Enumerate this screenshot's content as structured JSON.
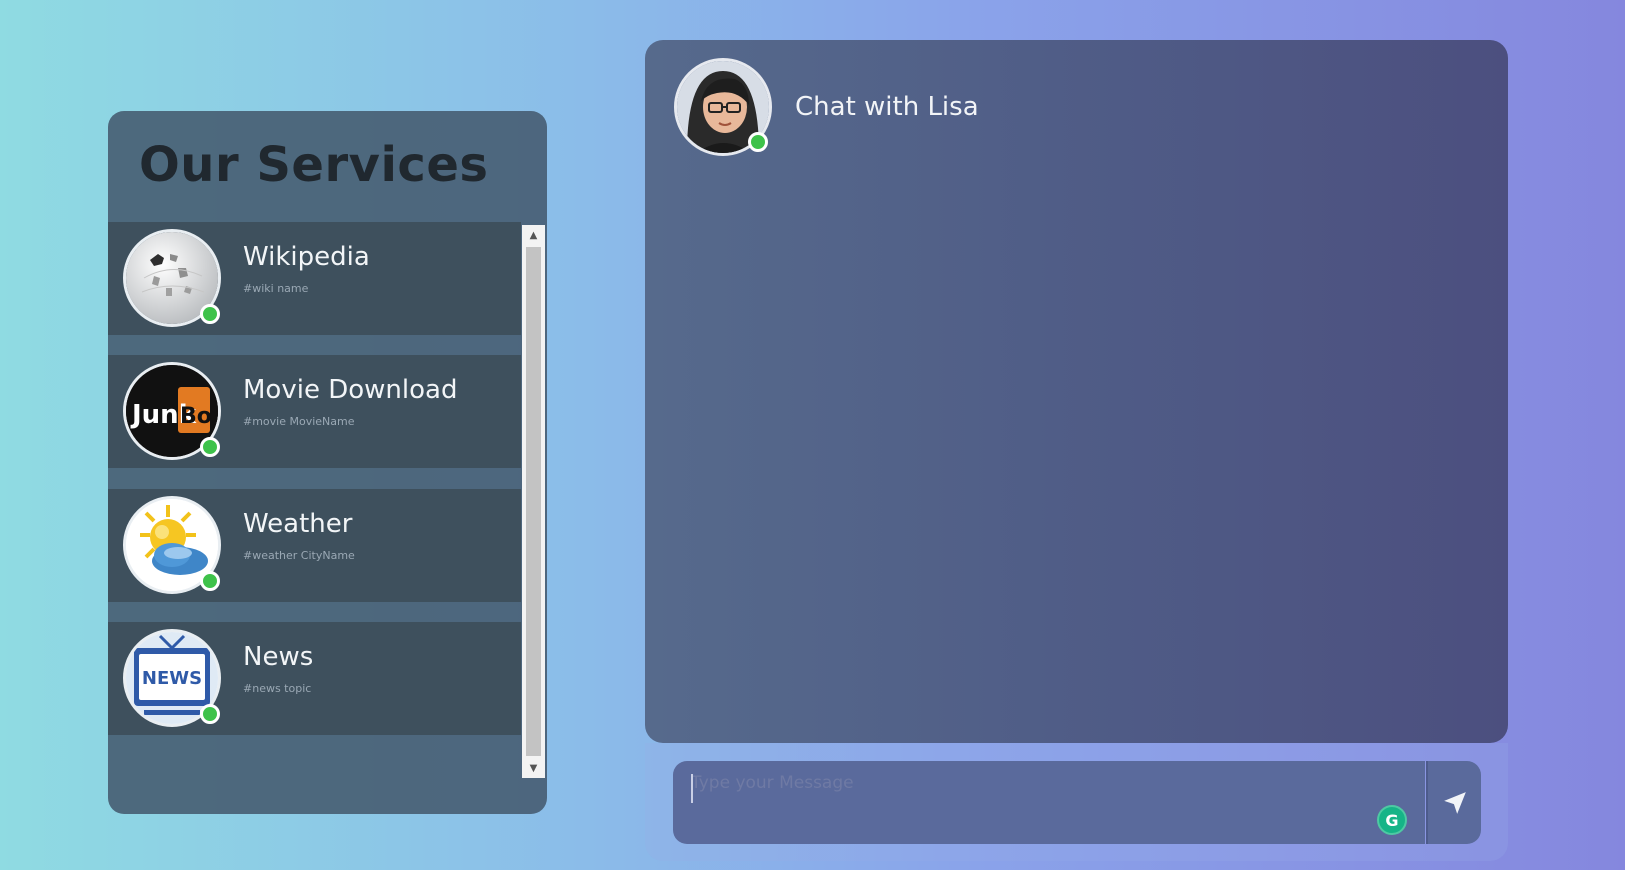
{
  "services_panel": {
    "title": "Our Services",
    "items": [
      {
        "name": "Wikipedia",
        "hint": "#wiki name",
        "icon": "wikipedia-globe-icon",
        "status": "online"
      },
      {
        "name": "Movie Download",
        "hint": "#movie MovieName",
        "icon": "junkbox-logo-icon",
        "status": "online"
      },
      {
        "name": "Weather",
        "hint": "#weather CityName",
        "icon": "sun-cloud-icon",
        "status": "online"
      },
      {
        "name": "News",
        "hint": "#news topic",
        "icon": "news-tv-icon",
        "status": "online"
      }
    ]
  },
  "chat": {
    "title": "Chat with Lisa",
    "avatar": "lisa-avatar",
    "status": "online",
    "input_placeholder": "Type your Message"
  },
  "colors": {
    "online": "#3ec24a",
    "grammar_badge": "#16b487"
  }
}
